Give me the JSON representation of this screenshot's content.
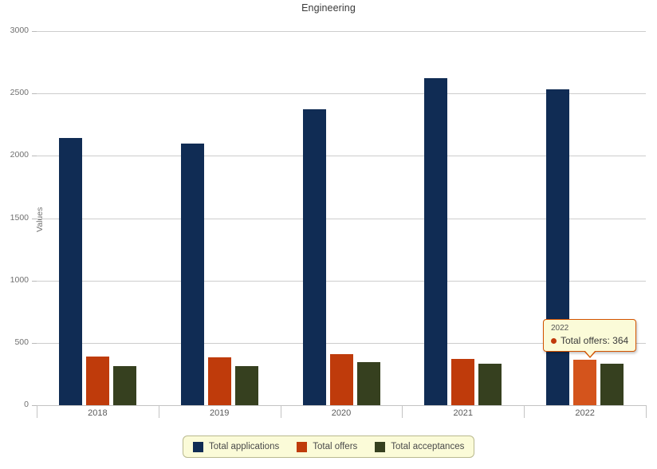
{
  "chart_data": {
    "type": "bar",
    "title": "Engineering",
    "xlabel": "",
    "ylabel": "Values",
    "categories": [
      "2018",
      "2019",
      "2020",
      "2021",
      "2022"
    ],
    "series": [
      {
        "name": "Total applications",
        "color": "#102c54",
        "values": [
          2140,
          2095,
          2370,
          2620,
          2535
        ]
      },
      {
        "name": "Total offers",
        "color": "#bf3b0b",
        "values": [
          390,
          385,
          410,
          370,
          364
        ]
      },
      {
        "name": "Total acceptances",
        "color": "#36401f",
        "values": [
          315,
          315,
          345,
          330,
          330
        ]
      }
    ],
    "ylim": [
      0,
      3000
    ],
    "yticks": [
      0,
      500,
      1000,
      1500,
      2000,
      2500,
      3000
    ],
    "ytick_labels": [
      "0",
      "500",
      "1000",
      "1500",
      "2000",
      "2500",
      "3000"
    ],
    "grid": true,
    "legend_position": "bottom"
  },
  "legend": {
    "items": [
      {
        "label": "Total applications",
        "color": "#102c54"
      },
      {
        "label": "Total offers",
        "color": "#bf3b0b"
      },
      {
        "label": "Total acceptances",
        "color": "#36401f"
      }
    ]
  },
  "tooltip": {
    "category": "2022",
    "series_label": "Total offers",
    "value": "364",
    "text": "Total offers: 364",
    "marker_color": "#c0390b",
    "border_color": "#d35400",
    "background_color": "#fbfbd8"
  },
  "highlight": {
    "series": "Total offers",
    "category": "2022",
    "color": "#d4541c"
  }
}
